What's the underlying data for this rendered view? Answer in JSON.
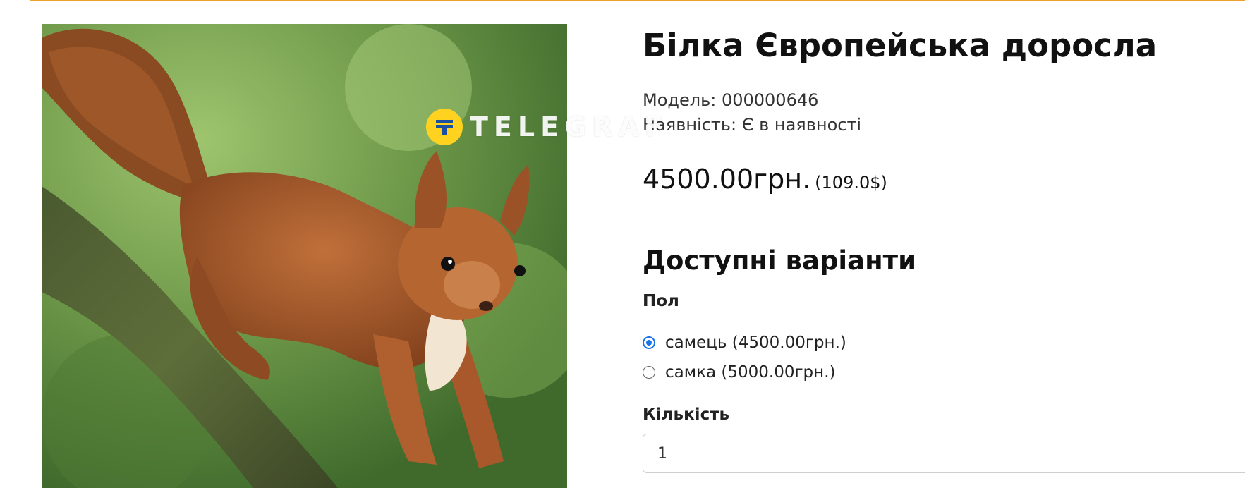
{
  "product": {
    "title": "Білка Європейська доросла",
    "model_label": "Модель: 000000646",
    "availability_label": "Наявність: Є в наявності",
    "price": "4500.00грн.",
    "price_usd": "(109.0$)"
  },
  "watermark": {
    "text": "TELEGRAF",
    "logo_letter": "T"
  },
  "options": {
    "section_title": "Доступні варіанти",
    "gender_label": "Пол",
    "gender_options": [
      {
        "label": "самець (4500.00грн.)",
        "selected": true
      },
      {
        "label": "самка (5000.00грн.)",
        "selected": false
      }
    ],
    "quantity_label": "Кількість",
    "quantity_value": "1"
  },
  "colors": {
    "accent_line": "#f0a030",
    "radio_selected": "#1a73e8",
    "watermark_badge": "#ffd21f",
    "watermark_logo": "#1b4fa0"
  },
  "image": {
    "subject": "squirrel-on-branch-photo"
  }
}
